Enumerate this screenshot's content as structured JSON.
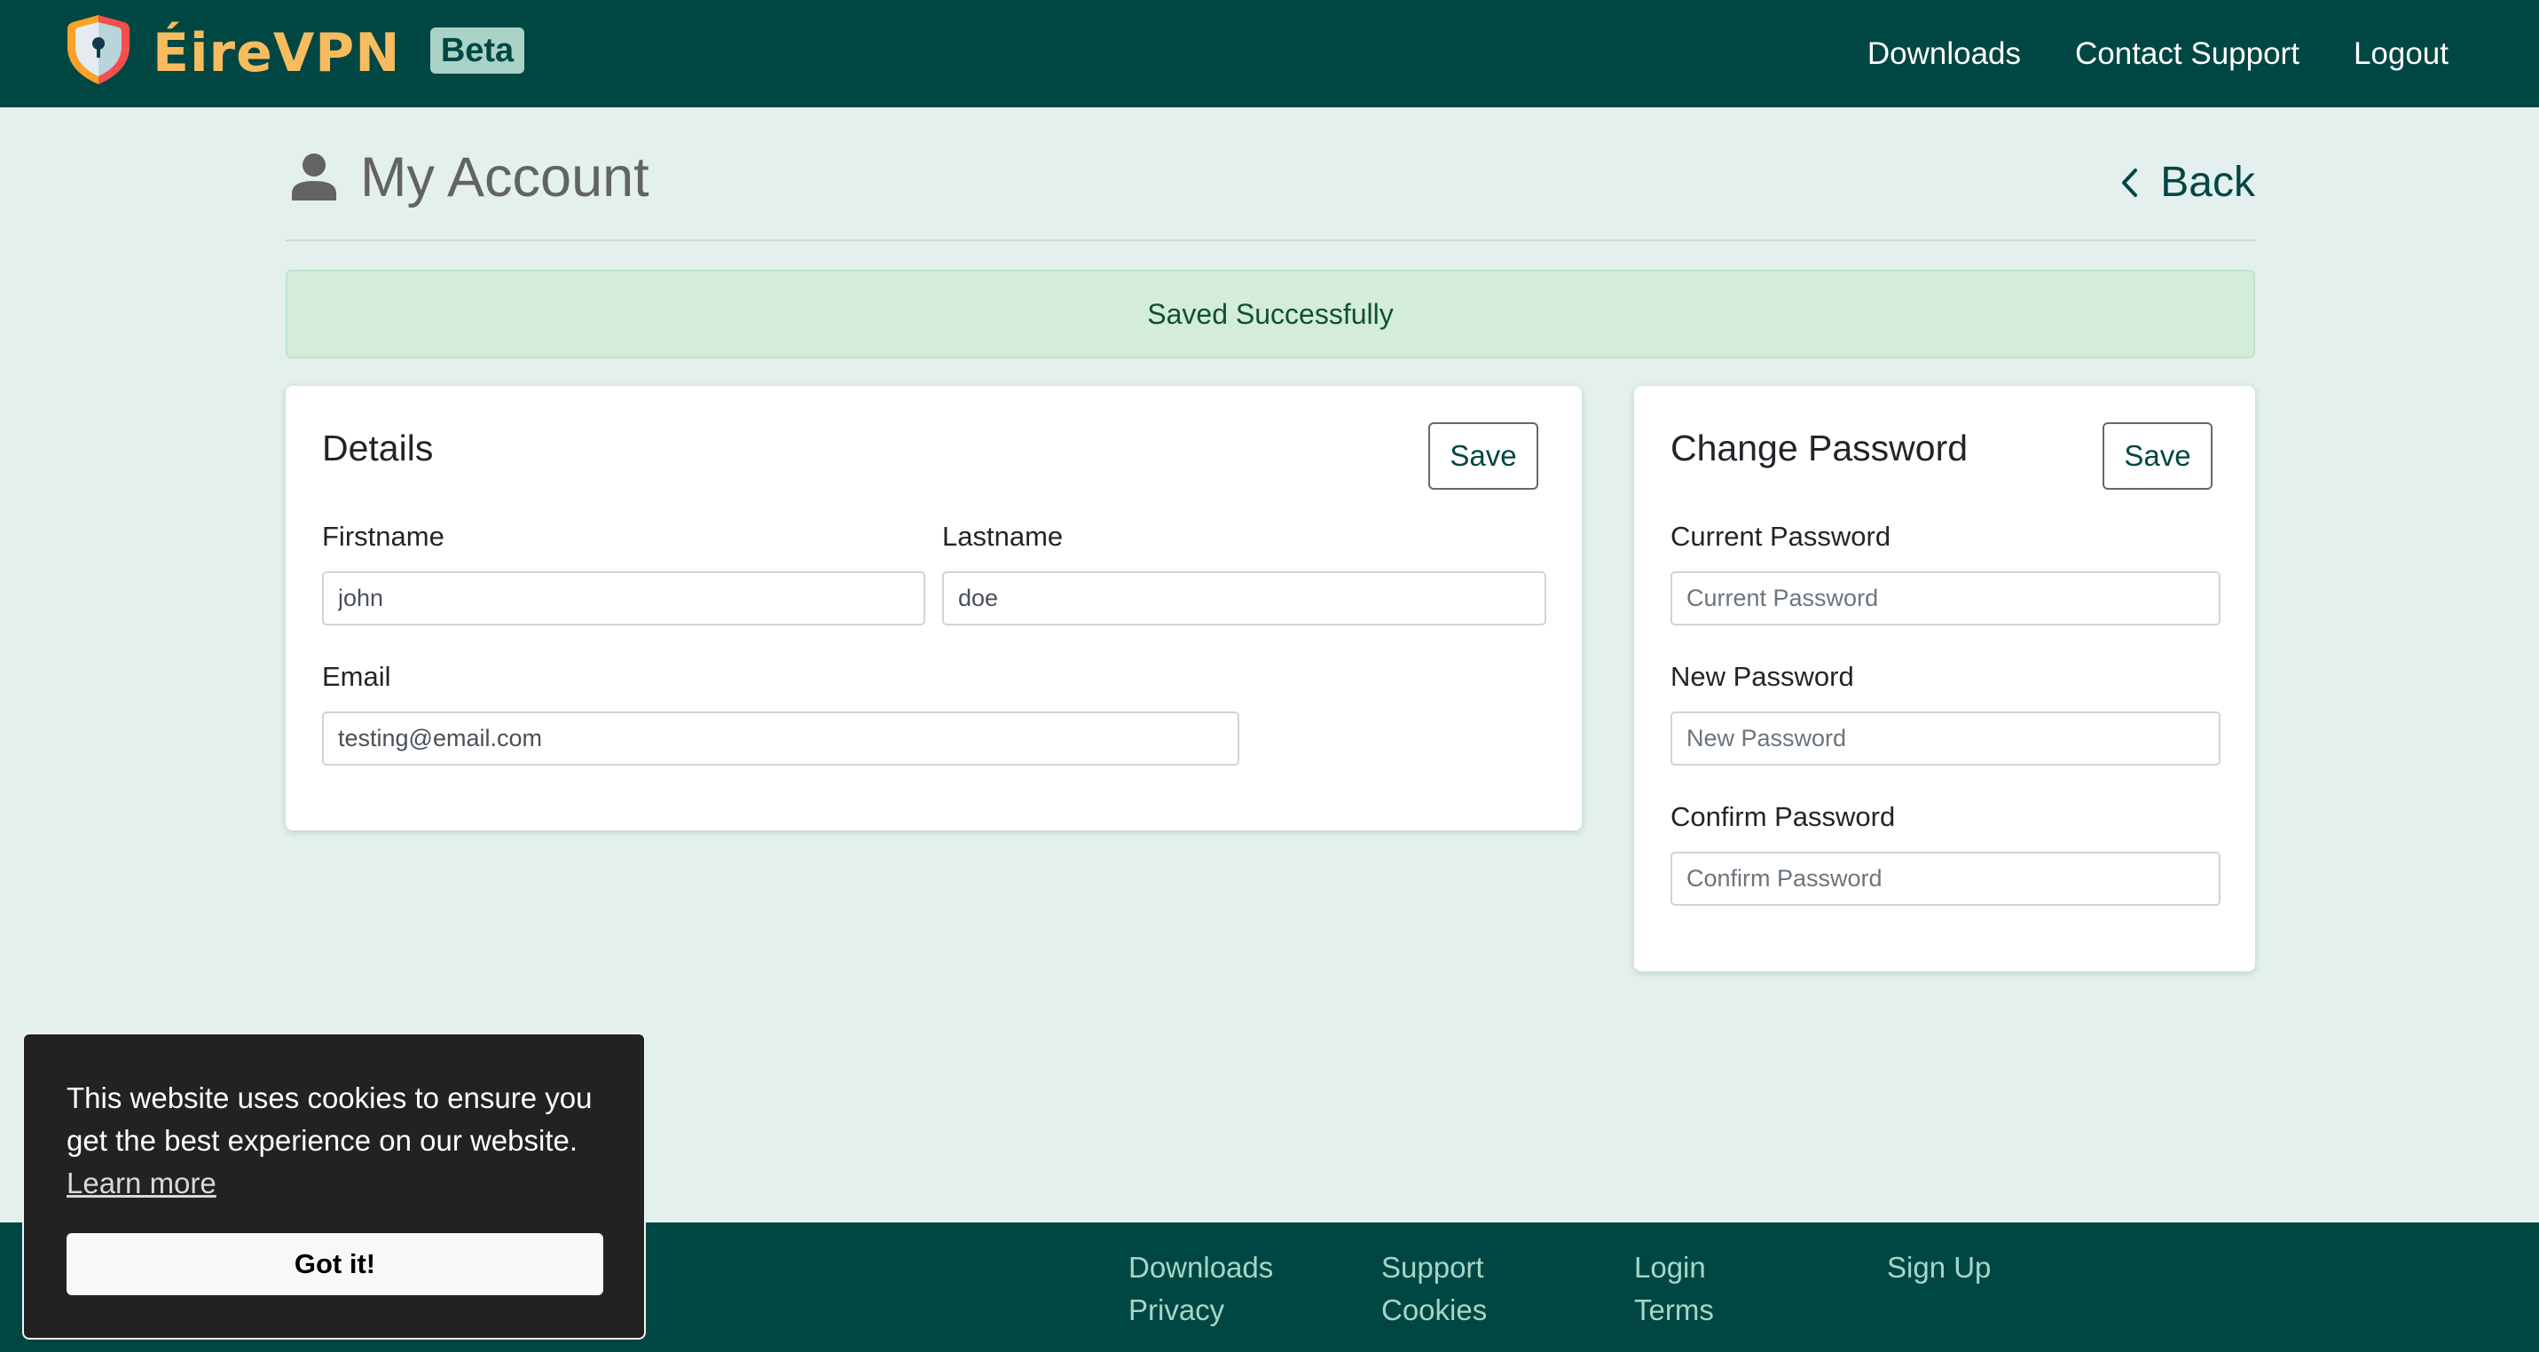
{
  "header": {
    "brand": "ÉireVPN",
    "badge": "Beta",
    "nav": [
      {
        "label": "Downloads"
      },
      {
        "label": "Contact Support"
      },
      {
        "label": "Logout"
      }
    ]
  },
  "page": {
    "title": "My Account",
    "title_icon": "person-icon",
    "back_label": "Back",
    "back_icon": "chevron-left-icon"
  },
  "alert": {
    "message": "Saved Successfully",
    "type": "success"
  },
  "details": {
    "title": "Details",
    "save_label": "Save",
    "firstname": {
      "label": "Firstname",
      "value": "john"
    },
    "lastname": {
      "label": "Lastname",
      "value": "doe"
    },
    "email": {
      "label": "Email",
      "value": "testing@email.com"
    }
  },
  "password": {
    "title": "Change Password",
    "save_label": "Save",
    "current": {
      "label": "Current Password",
      "placeholder": "Current Password",
      "value": ""
    },
    "new": {
      "label": "New Password",
      "placeholder": "New Password",
      "value": ""
    },
    "confirm": {
      "label": "Confirm Password",
      "placeholder": "Confirm Password",
      "value": ""
    }
  },
  "footer": {
    "links": [
      {
        "label": "Downloads"
      },
      {
        "label": "Support"
      },
      {
        "label": "Login"
      },
      {
        "label": "Sign Up"
      },
      {
        "label": "Privacy"
      },
      {
        "label": "Cookies"
      },
      {
        "label": "Terms"
      }
    ]
  },
  "cookie_banner": {
    "message": "This website uses cookies to ensure you get the best experience on our website.",
    "learn_more": "Learn more",
    "accept_label": "Got it!"
  },
  "colors": {
    "brand_dark": "#004744",
    "brand_accent": "#f8bc5f",
    "page_bg": "#e3f0ed",
    "success_bg": "#d4ecdc",
    "success_text": "#0f5132"
  }
}
